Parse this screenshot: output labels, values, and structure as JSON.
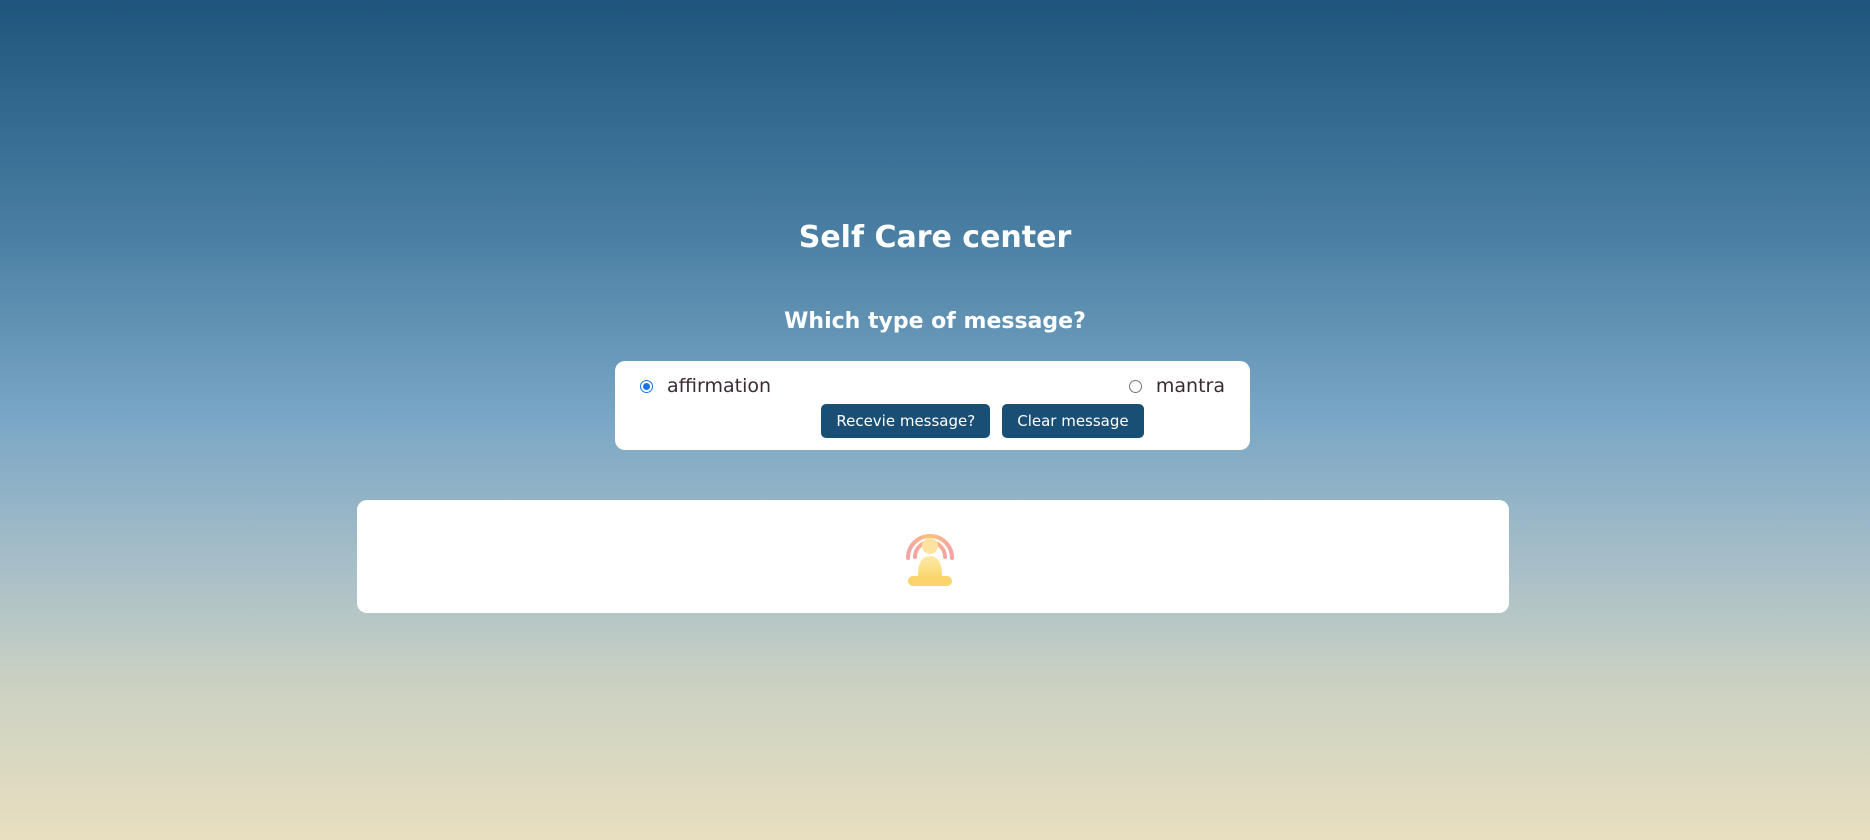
{
  "header": {
    "title": "Self Care center",
    "question": "Which type of message?"
  },
  "form": {
    "options": [
      {
        "label": "affirmation",
        "checked": true
      },
      {
        "label": "mantra",
        "checked": false
      }
    ],
    "receive_label": "Recevie message?",
    "clear_label": "Clear message"
  },
  "message": {
    "icon": "meditation-icon"
  },
  "colors": {
    "button": "#194e75",
    "radio_accent": "#1a73e8",
    "gradient_top": "#1e557c",
    "gradient_bottom": "#e9dfc0"
  }
}
